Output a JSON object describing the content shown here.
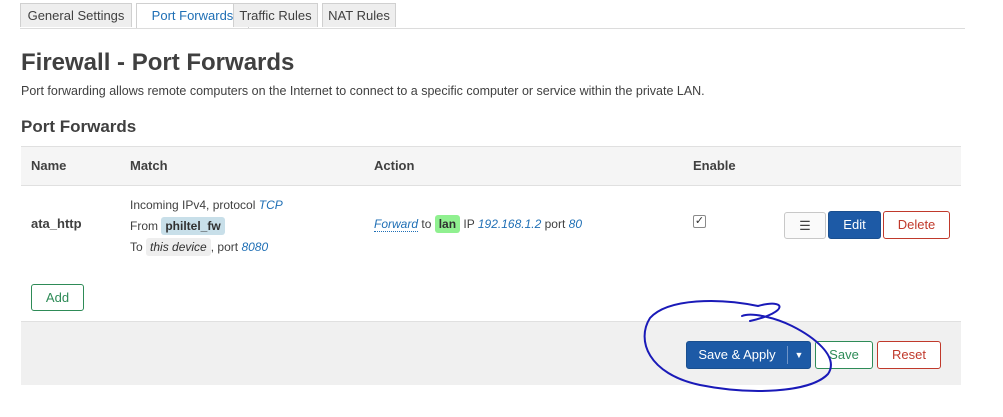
{
  "tabs": [
    {
      "label": "General Settings",
      "active": false
    },
    {
      "label": "Port Forwards",
      "active": true
    },
    {
      "label": "Traffic Rules",
      "active": false
    },
    {
      "label": "NAT Rules",
      "active": false
    }
  ],
  "page": {
    "title": "Firewall - Port Forwards",
    "description": "Port forwarding allows remote computers on the Internet to connect to a specific computer or service within the private LAN."
  },
  "section": {
    "title": "Port Forwards",
    "columns": [
      "Name",
      "Match",
      "Action",
      "Enable"
    ]
  },
  "rules": [
    {
      "name": "ata_http",
      "match": {
        "incoming_prefix": "Incoming IPv4, protocol",
        "protocol": "TCP",
        "from_label": "From",
        "from_zone": "philtel_fw",
        "to_label": "To",
        "to_target": "this device",
        "port_label": ", port",
        "port": "8080"
      },
      "action": {
        "verb": "Forward",
        "to_label": "to",
        "zone": "lan",
        "ip_label": "IP",
        "ip": "192.168.1.2",
        "port_label": "port",
        "port": "80"
      },
      "enabled": true,
      "check_mark": "✓",
      "menu_icon": "☰",
      "edit_label": "Edit",
      "delete_label": "Delete"
    }
  ],
  "add_label": "Add",
  "footer": {
    "save_apply_label": "Save & Apply",
    "caret_icon": "▼",
    "save_label": "Save",
    "reset_label": "Reset"
  },
  "colors": {
    "accent": "#1d5aa6",
    "link": "#1f6fb5",
    "positive": "#2e8b57",
    "negative": "#c0392b",
    "zone_wan": "#c8dfe9",
    "zone_lan": "#90f090",
    "scribble": "#1a1ab8"
  }
}
